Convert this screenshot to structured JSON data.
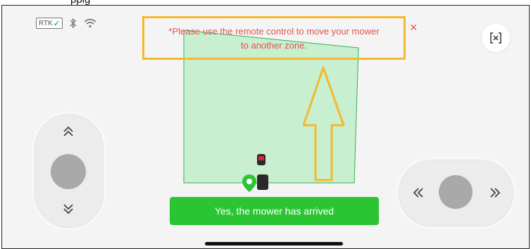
{
  "top_text": "ppig",
  "status_bar": {
    "rtk_label": "RTK",
    "rtk_check": "✓",
    "icons": [
      "bluetooth-icon",
      "wifi-icon"
    ]
  },
  "notice": {
    "message_line1": "*Please use the remote control to move your mower",
    "message_line2": "to another zone.",
    "close_glyph": "×"
  },
  "exit_icon": "exit-fullscreen-icon",
  "joystick_left": {
    "up_glyph": "up-double-chevron-icon",
    "down_glyph": "down-double-chevron-icon"
  },
  "joystick_right": {
    "left_glyph": "left-double-chevron-icon",
    "right_glyph": "right-double-chevron-icon"
  },
  "confirm_button": {
    "label": "Yes, the mower has arrived"
  },
  "colors": {
    "zone_fill": "#c8efd0",
    "zone_stroke": "#36b154",
    "notice_border": "#f5b82e",
    "notice_text": "#e8504f",
    "button_green": "#2bc534",
    "joystick_knob": "#a9a9a9"
  }
}
